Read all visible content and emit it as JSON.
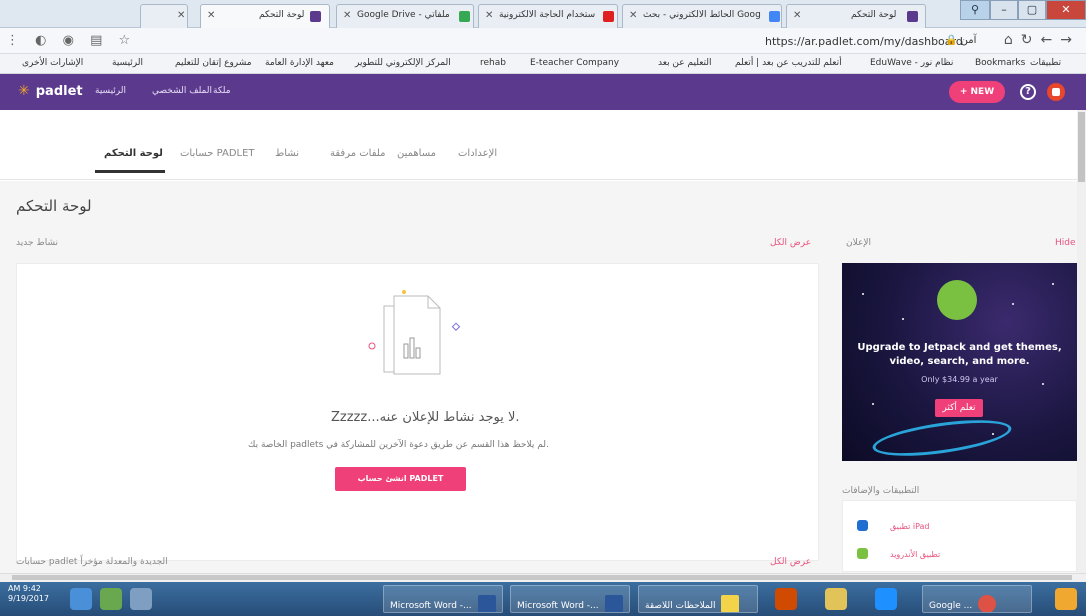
{
  "browser": {
    "tabs": [
      {
        "title": "لوحة التحكم",
        "fav_color": "#5b3a8e"
      },
      {
        "title": "Google Drive - ملفاتي",
        "fav_color": "#34a853"
      },
      {
        "title": "شرح استخدام الحاجة الالكترونية",
        "fav_color": "#e02020"
      },
      {
        "title": "الحائط الالكتروني - بحث Google",
        "fav_color": "#4285f4"
      },
      {
        "title": "لوحة التحكم",
        "fav_color": "#5b3a8e"
      }
    ],
    "url": "https://ar.padlet.com/my/dashboard",
    "security": "آمن",
    "bookmarks": [
      "تطبيقات",
      "Bookmarks",
      "EduWave - نظام نور",
      "أتعلم للتدريب عن بعد | أتعلم",
      "التعليم عن بعد",
      "E-teacher Company",
      "rehab",
      "المركز الإلكتروني للتطوير",
      "معهد الإدارة العامة",
      "مشروع إتقان للتعليم",
      "الرئيسية",
      "الإشارات الأخرى"
    ]
  },
  "header": {
    "logo": "padlet",
    "nav": [
      "الرئيسية",
      "الملف الشخصي",
      "ملكة"
    ],
    "new_label": "+ NEW",
    "help": "?"
  },
  "subtabs": [
    "لوحة التحكم",
    "حسابات PADLET",
    "نشاط",
    "ملفات مرفقة",
    "مساهمين",
    "الإعدادات"
  ],
  "page": {
    "title": "لوحة التحكم",
    "activity_label": "نشاط جديد",
    "view_all": "عرض الكل",
    "empty_title": "Zzzzz...لا يوجد نشاط للإعلان عنه.",
    "empty_sub": "الخاصة بك padlets لم يلاحظ هذا القسم عن طريق دعوة الآخرين للمشاركة في.",
    "cta": "انشئ حساب PADLET",
    "recent_label": "حسابات padlet الجديدة والمعدلة مؤخراً",
    "view_all_2": "عرض الكل"
  },
  "ad": {
    "label": "الإعلان",
    "hide": "Hide",
    "headline": "Upgrade to Jetpack and get themes, video, search, and more.",
    "price": "Only $34.99 a year",
    "button": "تعلم أكثر"
  },
  "apps": {
    "label": "التطبيقات والإضافات",
    "items": [
      {
        "label": "تطبيق iPad",
        "color": "#1f6fd1"
      },
      {
        "label": "تطبيق الأندرويد",
        "color": "#7ac142"
      }
    ]
  },
  "taskbar": {
    "time": "AM 9:42",
    "date": "9/19/2017",
    "items": [
      {
        "label": "Microsoft Word -...",
        "color": "#2b579a"
      },
      {
        "label": "Microsoft Word -...",
        "color": "#2b579a"
      },
      {
        "label": "الملاحظات اللاصقة",
        "color": "#f3d34a"
      },
      {
        "label": "Google ...",
        "color": "#de5246"
      }
    ]
  }
}
